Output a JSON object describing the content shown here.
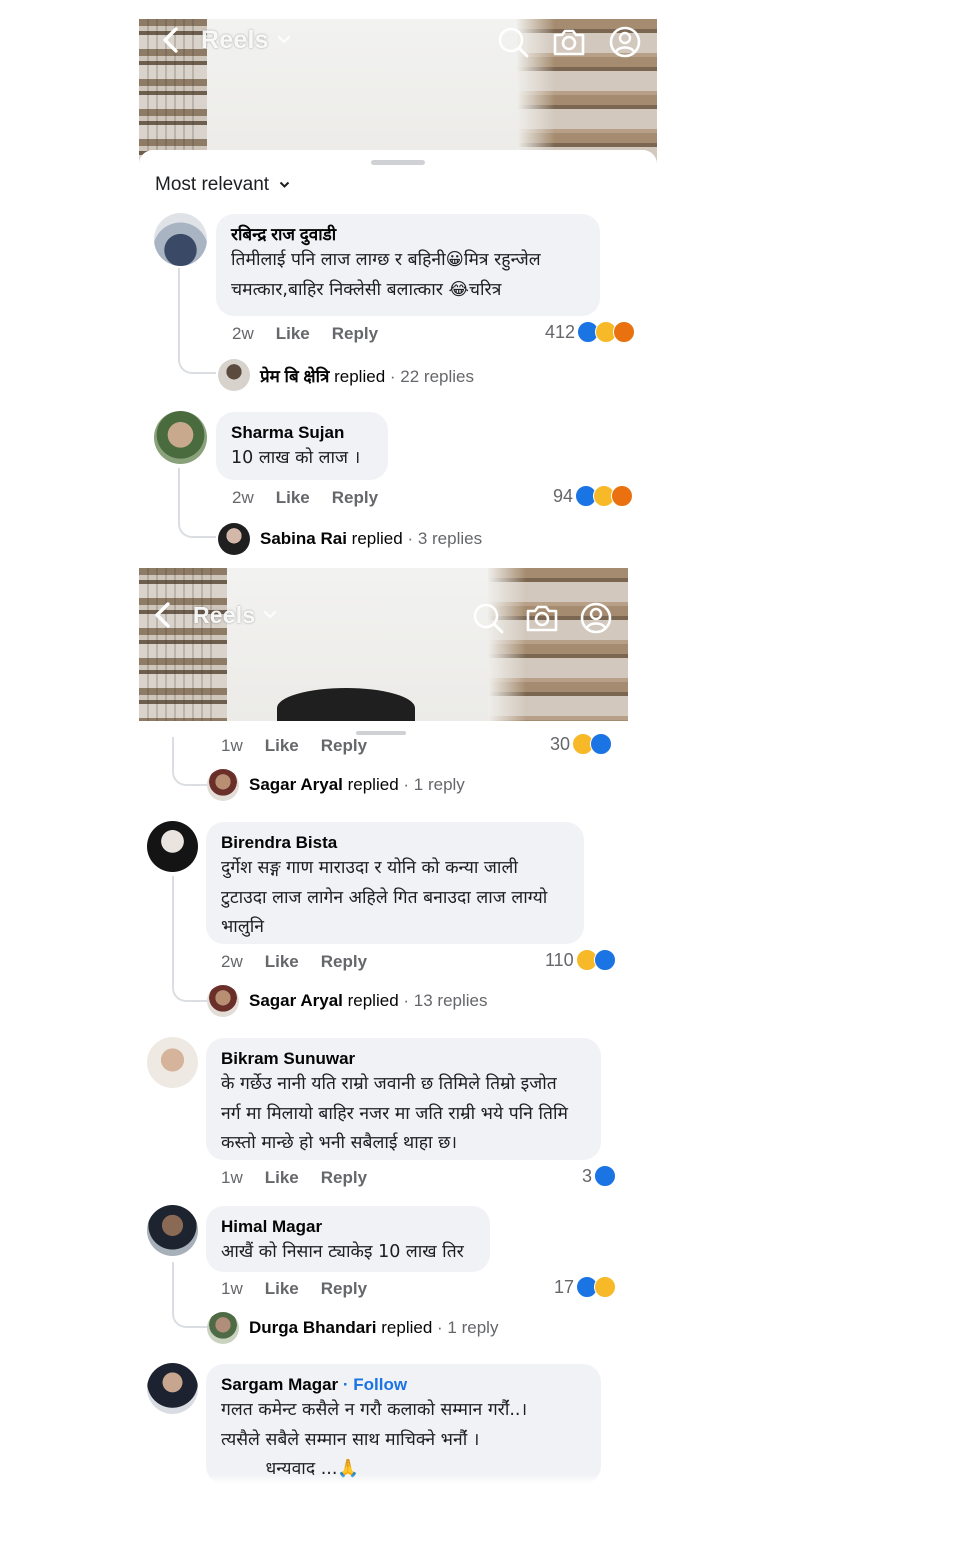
{
  "header": {
    "title": "Reels",
    "icons": [
      "back-icon",
      "chevron-down-icon",
      "search-icon",
      "camera-icon",
      "profile-icon"
    ]
  },
  "sort": {
    "label": "Most relevant"
  },
  "comments_top": [
    {
      "author": "रबिन्द्र राज दुवाडी",
      "lines": [
        "तिमीलाई पनि लाज लाग्छ र बहिनी😀मित्र रहुन्जेल",
        "चमत्कार,बाहिर निक्लेसी बलात्कार 😂चरित्र"
      ],
      "time": "2w",
      "like": "Like",
      "reply": "Reply",
      "reactions": {
        "count": "412",
        "types": [
          "like",
          "haha",
          "angry"
        ]
      },
      "replies": {
        "who": "प्रेम बि क्षेत्रि",
        "verb": "replied",
        "count": "· 22 replies"
      }
    },
    {
      "author": "Sharma Sujan",
      "lines": [
        "10 लाख को लाज ।"
      ],
      "time": "2w",
      "like": "Like",
      "reply": "Reply",
      "reactions": {
        "count": "94",
        "types": [
          "like",
          "haha",
          "angry"
        ]
      },
      "replies": {
        "who": "Sabina Rai",
        "verb": "replied",
        "count": "· 3 replies"
      }
    }
  ],
  "comments_bottom": [
    {
      "author": "",
      "lines": [],
      "time": "1w",
      "like": "Like",
      "reply": "Reply",
      "reactions": {
        "count": "30",
        "types": [
          "haha",
          "like"
        ]
      },
      "replies": {
        "who": "Sagar Aryal",
        "verb": "replied",
        "count": "· 1 reply"
      }
    },
    {
      "author": "Birendra Bista",
      "lines": [
        "दुर्गेश सङ्ग गाण माराउदा र योनि को कन्या जाली",
        "टुटाउदा लाज लागेन अहिले गित बनाउदा लाज लाग्यो",
        "भालुनि"
      ],
      "time": "2w",
      "like": "Like",
      "reply": "Reply",
      "reactions": {
        "count": "110",
        "types": [
          "haha",
          "like"
        ]
      },
      "replies": {
        "who": "Sagar Aryal",
        "verb": "replied",
        "count": "· 13 replies"
      }
    },
    {
      "author": "Bikram Sunuwar",
      "lines": [
        "के गर्छेउ नानी यति राम्रो जवानी छ तिमिले तिम्रो इजोत",
        "नर्ग मा मिलायो बाहिर नजर मा जति राम्री भये पनि तिमि",
        "कस्तो मान्छे हो भनी सबैलाई थाहा छ।"
      ],
      "time": "1w",
      "like": "Like",
      "reply": "Reply",
      "reactions": {
        "count": "3",
        "types": [
          "like"
        ]
      }
    },
    {
      "author": "Himal Magar",
      "lines": [
        "आखैं को निसान ट्याकेइ 10 लाख तिर"
      ],
      "time": "1w",
      "like": "Like",
      "reply": "Reply",
      "reactions": {
        "count": "17",
        "types": [
          "like",
          "haha"
        ]
      },
      "replies": {
        "who": "Durga Bhandari",
        "verb": "replied",
        "count": "· 1 reply"
      }
    },
    {
      "author": "Sargam Magar",
      "follow": "· Follow",
      "lines": [
        "गलत कमेन्ट कसैले न गरौ कलाकाे सम्मान गराैंं..।",
        "त्यसैले सबैले सम्मान साथ माचिक्ने भनाैंं ।",
        "        धन्यवाद ...🙏"
      ]
    }
  ],
  "colors": {
    "bubble": "#f0f2f5",
    "meta_text": "#65676b",
    "like_blue": "#1b74e4",
    "haha_yellow": "#f7b928",
    "angry_orange": "#e9710f",
    "thread_line": "#dadde1"
  }
}
